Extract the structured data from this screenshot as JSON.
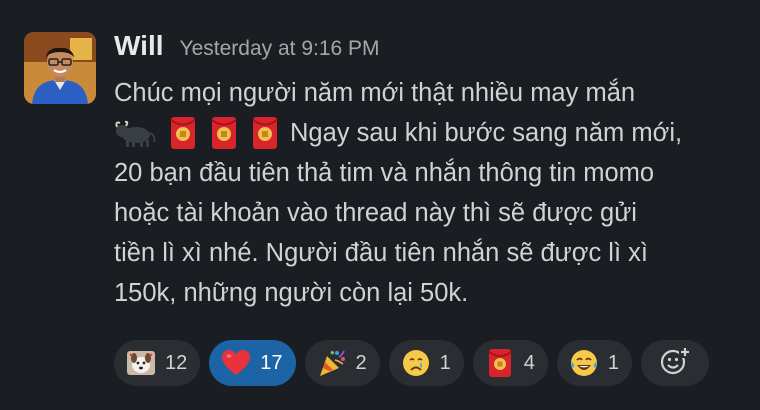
{
  "message": {
    "author": "Will",
    "timestamp": "Yesterday at 9:16 PM",
    "lines": [
      "Chúc mọi người năm mới thật nhiều may mắn",
      "Ngay sau khi bước sang năm mới,",
      "20 bạn đầu tiên thả tim và nhắn thông tin momo",
      "hoặc tài khoản vào thread này thì sẽ được gửi",
      "tiền lì xì nhé. Người đầu tiên nhắn sẽ được lì xì",
      "150k, những người còn lại 50k."
    ],
    "inline_emojis": [
      "ox-icon",
      "red-envelope-icon",
      "red-envelope-icon",
      "red-envelope-icon"
    ]
  },
  "reactions": [
    {
      "icon": "dancing-dog-icon",
      "count": "12",
      "active": false
    },
    {
      "icon": "red-heart-icon",
      "count": "17",
      "active": true
    },
    {
      "icon": "party-popper-icon",
      "count": "2",
      "active": false
    },
    {
      "icon": "crying-face-icon",
      "count": "1",
      "active": false
    },
    {
      "icon": "red-envelope-icon",
      "count": "4",
      "active": false
    },
    {
      "icon": "tears-of-joy-icon",
      "count": "1",
      "active": false
    }
  ],
  "add_reaction": {
    "icon": "add-reaction-icon"
  },
  "colors": {
    "background": "#1a1d21",
    "reaction_bg": "#2a2d32",
    "active_reaction_bg": "#1d64a6",
    "text": "#d1d2d3",
    "muted": "#a5a6a8"
  }
}
